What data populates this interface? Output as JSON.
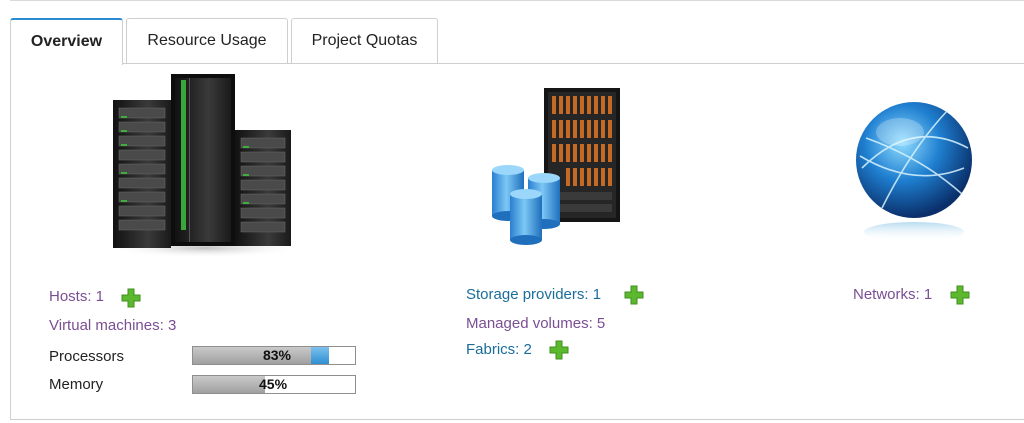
{
  "tabs": [
    {
      "label": "Overview",
      "active": true
    },
    {
      "label": "Resource Usage",
      "active": false
    },
    {
      "label": "Project Quotas",
      "active": false
    }
  ],
  "compute": {
    "image_icon": "server-rack-icon",
    "hosts_label": "Hosts: 1",
    "vms_label": "Virtual machines: 3",
    "processors": {
      "label": "Processors",
      "percent_text": "83%",
      "value": 0.83
    },
    "memory": {
      "label": "Memory",
      "percent_text": "45%",
      "value": 0.45
    }
  },
  "storage": {
    "image_icon": "storage-array-icon",
    "providers_label": "Storage providers: 1",
    "volumes_label": "Managed volumes: 5",
    "fabrics_label": "Fabrics: 2"
  },
  "network": {
    "image_icon": "globe-icon",
    "networks_label": "Networks: 1"
  },
  "colors": {
    "accent": "#2a8bd0",
    "link_purple": "#7a4f93",
    "link_blue": "#1a6d9b",
    "plus_green": "#5cb82e"
  }
}
